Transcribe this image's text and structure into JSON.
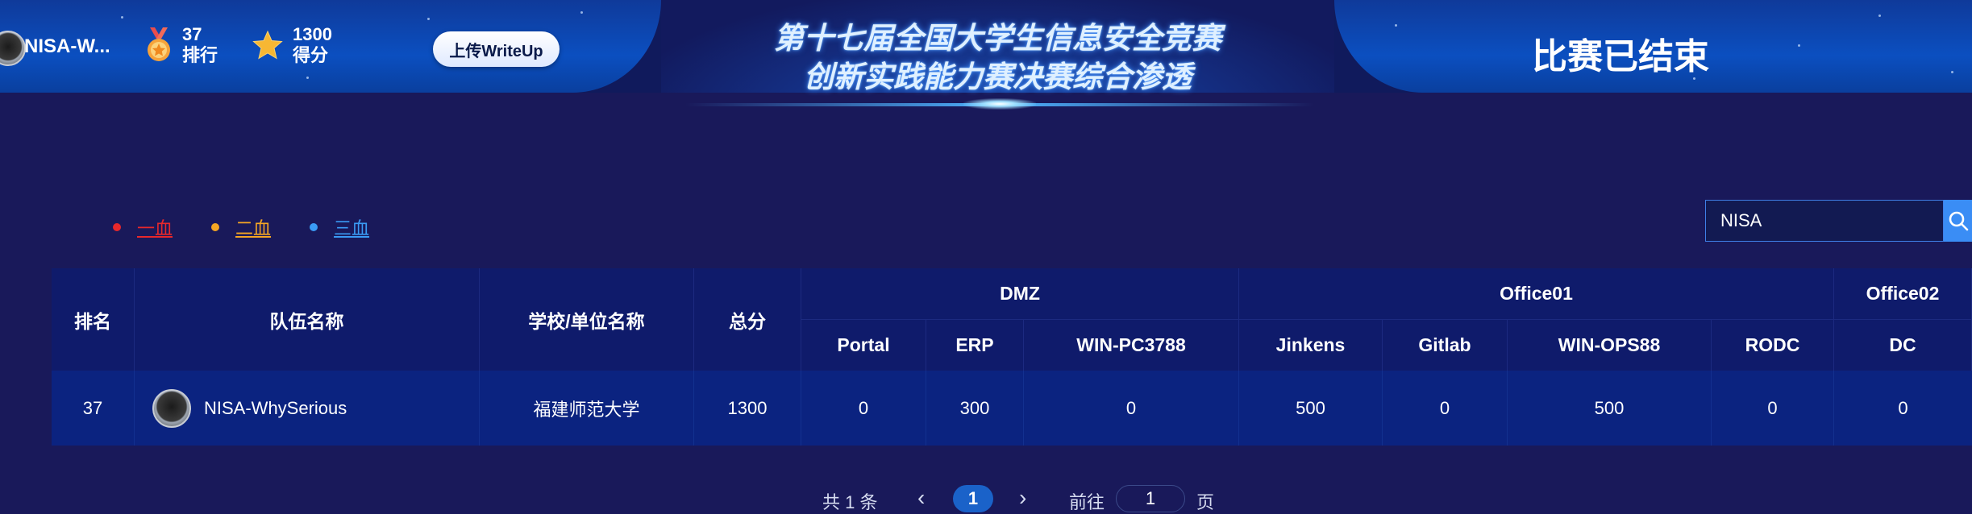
{
  "header": {
    "team_name": "NISA-W...",
    "rank_value": "37",
    "rank_label": "排行",
    "score_value": "1300",
    "score_label": "得分",
    "upload_label": "上传WriteUp",
    "title_line1": "第十七届全国大学生信息安全竞赛",
    "title_line2": "创新实践能力赛决赛综合渗透",
    "status": "比赛已结束"
  },
  "legend": [
    {
      "label": "一血",
      "color": "#e8282b"
    },
    {
      "label": "二血",
      "color": "#f5a623"
    },
    {
      "label": "三血",
      "color": "#3a9bf5"
    }
  ],
  "search": {
    "value": "NISA"
  },
  "table": {
    "headers": {
      "rank": "排名",
      "team": "队伍名称",
      "school": "学校/单位名称",
      "total": "总分",
      "groups": [
        "DMZ",
        "Office01",
        "Office02"
      ],
      "subs": [
        "Portal",
        "ERP",
        "WIN-PC3788",
        "Jinkens",
        "Gitlab",
        "WIN-OPS88",
        "RODC",
        "DC"
      ]
    },
    "rows": [
      {
        "rank": "37",
        "team": "NISA-WhySerious",
        "school": "福建师范大学",
        "total": "1300",
        "scores": [
          "0",
          "300",
          "0",
          "500",
          "0",
          "500",
          "0",
          "0"
        ]
      }
    ]
  },
  "pager": {
    "total_text": "共 1 条",
    "prev": "‹",
    "current": "1",
    "next": "›",
    "goto": "前往",
    "goto_value": "1",
    "page_unit": "页"
  },
  "colors": {
    "header_blue": "#0b4fc0",
    "background": "#19195a",
    "row_bg": "#0b2380",
    "accent": "#3a8df5"
  }
}
